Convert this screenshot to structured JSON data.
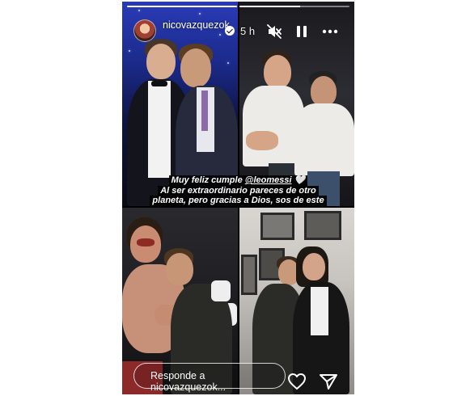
{
  "story": {
    "progress_segments": [
      1,
      0.55
    ],
    "header": {
      "username": "nicovazquezok",
      "verified": true,
      "time_ago": "5 h",
      "icons": [
        "mute-icon",
        "pause-icon",
        "more-icon"
      ]
    },
    "caption": {
      "line1_before": "Muy feliz cumple ",
      "mention": "@leomessi",
      "line1_after": " 🤍",
      "line2": "Al ser extraordinario pareces de otro",
      "line3": "planeta, pero gracias a Dios, sos de este"
    },
    "reply": {
      "placeholder": "Responde a nicovazquezok..."
    },
    "actions": [
      "heart-icon",
      "send-icon"
    ],
    "colors": {
      "background": "#000000",
      "text": "#ffffff"
    }
  }
}
